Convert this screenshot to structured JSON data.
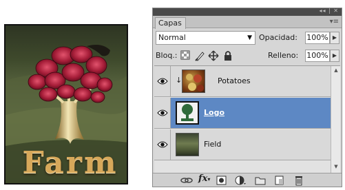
{
  "artwork": {
    "title_text": "Farm"
  },
  "panel": {
    "tab_label": "Capas",
    "blend_mode": "Normal",
    "opacity_label": "Opacidad:",
    "opacity_value": "100%",
    "lock_label": "Bloq.:",
    "fill_label": "Relleno:",
    "fill_value": "100%",
    "layers": [
      {
        "name": "Potatoes",
        "visible": true,
        "clipped": true,
        "selected": false
      },
      {
        "name": "Logo",
        "visible": true,
        "clipped": false,
        "selected": true
      },
      {
        "name": "Field",
        "visible": true,
        "clipped": false,
        "selected": false
      }
    ],
    "bottom_icons": [
      "link-icon",
      "fx-icon",
      "mask-icon",
      "adjustment-icon",
      "folder-icon",
      "new-layer-icon",
      "trash-icon"
    ]
  },
  "colors": {
    "selected_layer": "#5d88c4",
    "panel_bg": "#d6d6d6"
  }
}
